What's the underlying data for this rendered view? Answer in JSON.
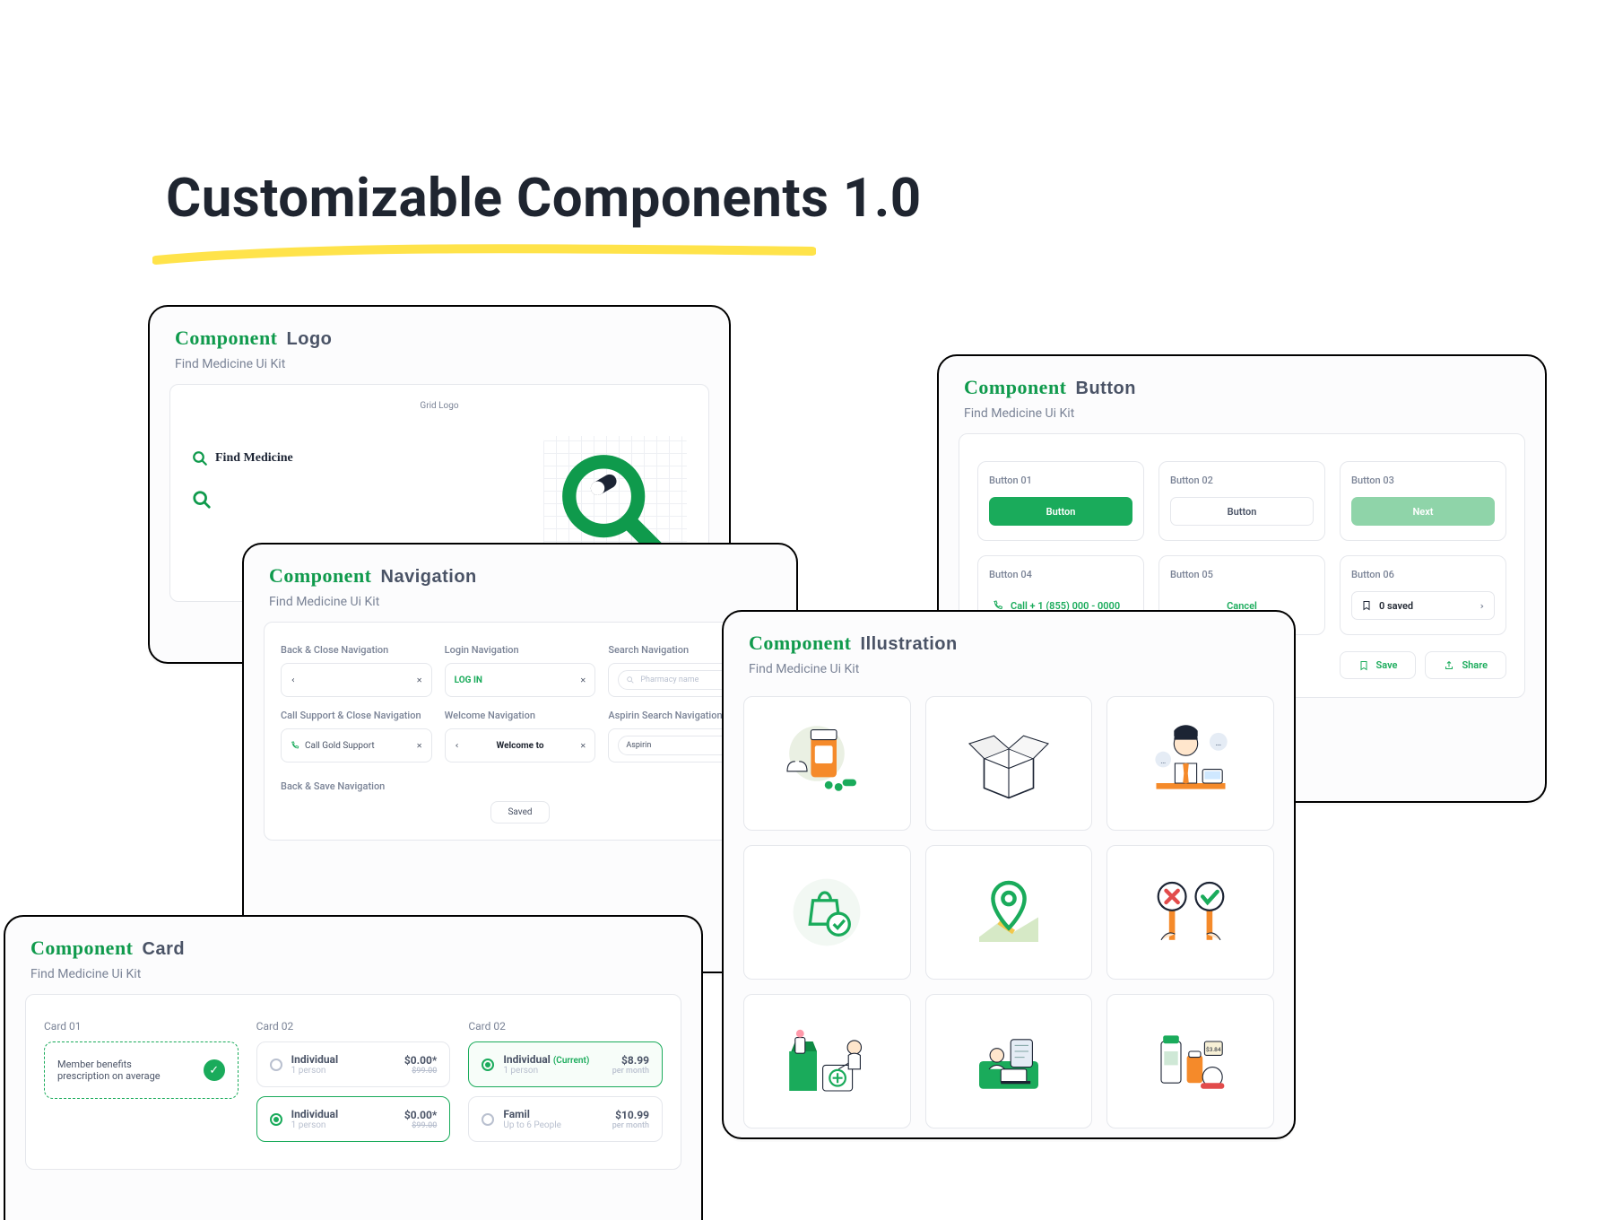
{
  "title": "Customizable Components 1.0",
  "kit_name": "Find Medicine Ui Kit",
  "brand_word": "Component",
  "logo": {
    "heading": "Logo",
    "grid_label": "Grid Logo",
    "mark_text": "Find Medicine"
  },
  "nav": {
    "heading": "Navigation",
    "items": {
      "back_close": {
        "label": "Back & Close Navigation"
      },
      "login": {
        "label": "Login Navigation",
        "btn": "LOG IN"
      },
      "search": {
        "label": "Search Navigation",
        "placeholder": "Pharmacy name"
      },
      "call_close": {
        "label": "Call Support & Close Navigation",
        "btn": "Call Gold Support"
      },
      "welcome": {
        "label": "Welcome Navigation",
        "text": "Welcome to"
      },
      "aspirin": {
        "label": "Aspirin Search Navigation",
        "value": "Aspirin"
      },
      "back_save": {
        "label": "Back & Save  Navigation",
        "pill": "Saved"
      }
    }
  },
  "buttons": {
    "heading": "Button",
    "b01": {
      "label": "Button 01",
      "text": "Button"
    },
    "b02": {
      "label": "Button 02",
      "text": "Button"
    },
    "b03": {
      "label": "Button 03",
      "text": "Next"
    },
    "b04": {
      "label": "Button 04",
      "text": "Call + 1 (855) 000 - 0000"
    },
    "b05": {
      "label": "Button 05",
      "text": "Cancel"
    },
    "b06": {
      "label": "Button 06",
      "text": "0 saved"
    },
    "save": "Save",
    "share": "Share"
  },
  "illustration": {
    "heading": "Illustration"
  },
  "card": {
    "heading": "Card",
    "c01": {
      "label": "Card 01",
      "text": "Member benefits prescription on average"
    },
    "c02": {
      "label": "Card 02",
      "a": {
        "title": "Individual",
        "sub": "1 person",
        "price": "$0.00*",
        "strike": "$99.00"
      },
      "b": {
        "title": "Individual",
        "sub": "1 person",
        "price": "$0.00*",
        "strike": "$99.00"
      }
    },
    "c03": {
      "label": "Card 02",
      "a": {
        "title": "Individual",
        "current": "(Current)",
        "sub": "1 person",
        "price": "$8.99",
        "per": "per month"
      },
      "b": {
        "title": "Famil",
        "sub": "Up to 6 People",
        "price": "$10.99",
        "per": "per month"
      }
    }
  }
}
